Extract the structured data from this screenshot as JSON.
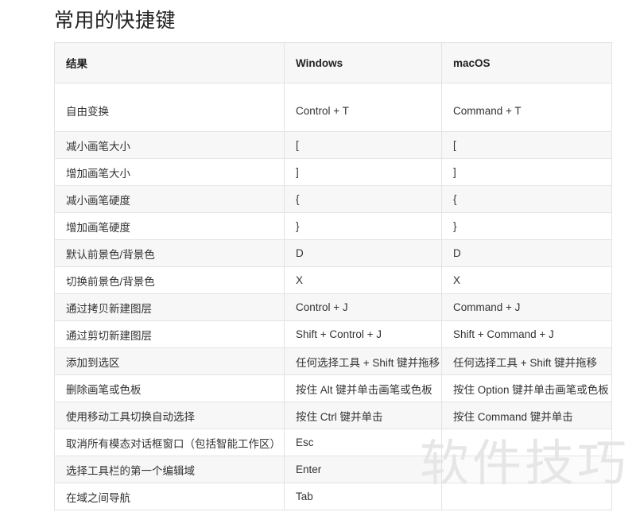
{
  "page": {
    "title": "常用的快捷键",
    "watermark": "软件技巧",
    "accent_color": "#f7f7f7",
    "border_color": "#e3e3e3",
    "text_color": "#333333",
    "watermark_color": "#e6e6e6"
  },
  "table": {
    "columns": [
      "结果",
      "Windows",
      "macOS"
    ],
    "rows": [
      {
        "result": "自由变换",
        "windows": "Control + T",
        "macos": "Command + T"
      },
      {
        "result": "减小画笔大小",
        "windows": "[",
        "macos": "["
      },
      {
        "result": "增加画笔大小",
        "windows": "]",
        "macos": "]"
      },
      {
        "result": "减小画笔硬度",
        "windows": "{",
        "macos": "{"
      },
      {
        "result": "增加画笔硬度",
        "windows": "}",
        "macos": "}"
      },
      {
        "result": "默认前景色/背景色",
        "windows": "D",
        "macos": "D"
      },
      {
        "result": "切换前景色/背景色",
        "windows": "X",
        "macos": "X"
      },
      {
        "result": "通过拷贝新建图层",
        "windows": "Control + J",
        "macos": "Command + J"
      },
      {
        "result": "通过剪切新建图层",
        "windows": "Shift + Control + J",
        "macos": "Shift + Command + J"
      },
      {
        "result": "添加到选区",
        "windows": "任何选择工具 + Shift 键并拖移",
        "macos": "任何选择工具 + Shift 键并拖移"
      },
      {
        "result": "删除画笔或色板",
        "windows": "按住 Alt 键并单击画笔或色板",
        "macos": "按住 Option 键并单击画笔或色板"
      },
      {
        "result": "使用移动工具切换自动选择",
        "windows": "按住 Ctrl 键并单击",
        "macos": "按住 Command 键并单击"
      },
      {
        "result": "取消所有模态对话框窗口（包括智能工作区）",
        "windows": "Esc",
        "macos": ""
      },
      {
        "result": "选择工具栏的第一个编辑域",
        "windows": "Enter",
        "macos": ""
      },
      {
        "result": "在域之间导航",
        "windows": "Tab",
        "macos": ""
      }
    ]
  }
}
